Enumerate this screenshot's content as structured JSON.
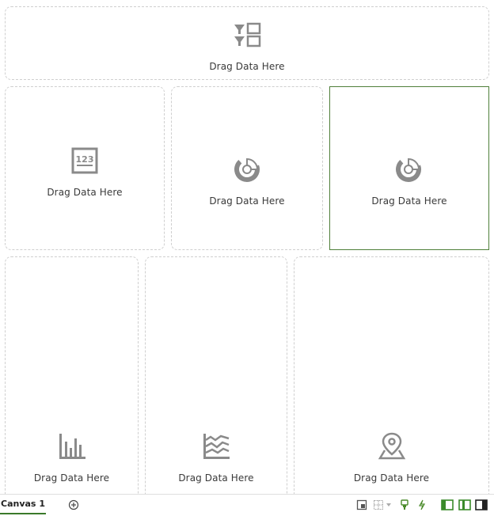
{
  "canvas": {
    "drop_label": "Drag Data Here",
    "cells": [
      {
        "id": "filter-bar",
        "icon": "filter-grid-icon"
      },
      {
        "id": "tile",
        "icon": "number-tile-icon"
      },
      {
        "id": "donut-1",
        "icon": "donut-chart-icon"
      },
      {
        "id": "donut-2",
        "icon": "donut-chart-icon",
        "selected": true
      },
      {
        "id": "bar",
        "icon": "bar-chart-icon"
      },
      {
        "id": "area",
        "icon": "area-chart-icon"
      },
      {
        "id": "map",
        "icon": "map-pin-icon"
      }
    ]
  },
  "tabs": [
    {
      "label": "Canvas 1"
    }
  ],
  "colors": {
    "accent": "#4f7f3a",
    "icon": "#8a8a8a"
  }
}
